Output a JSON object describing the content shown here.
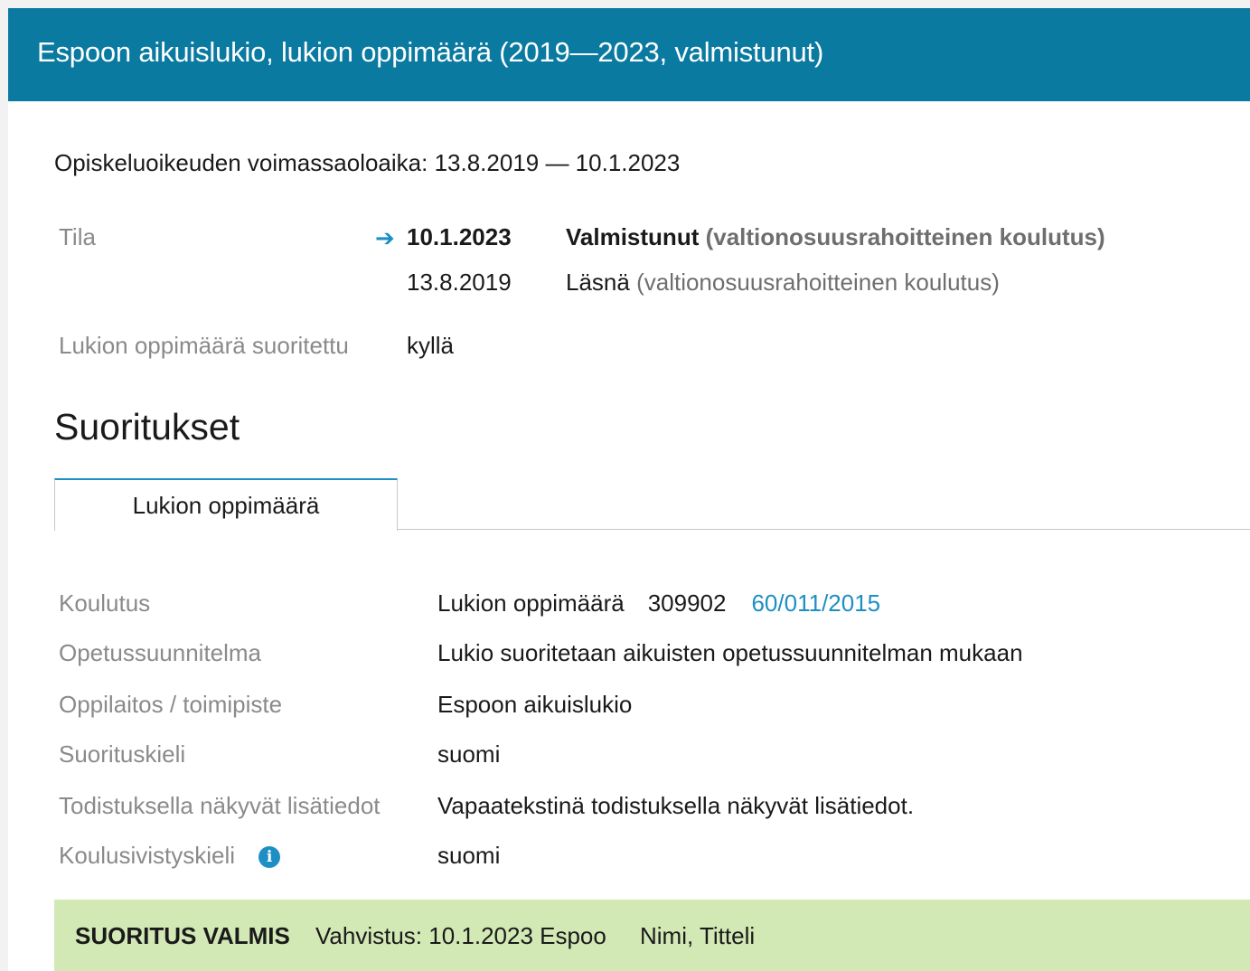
{
  "header": {
    "title": "Espoon aikuislukio, lukion oppimäärä (2019—2023, valmistunut)"
  },
  "validity": "Opiskeluoikeuden voimassaoloaika: 13.8.2019 — 10.1.2023",
  "tila": {
    "label": "Tila",
    "entries": [
      {
        "date": "10.1.2023",
        "state": "Valmistunut",
        "funding": "(valtionosuusrahoitteinen koulutus)",
        "current": true
      },
      {
        "date": "13.8.2019",
        "state": "Läsnä",
        "funding": "(valtionosuusrahoitteinen koulutus)",
        "current": false
      }
    ]
  },
  "completed": {
    "label": "Lukion oppimäärä suoritettu",
    "value": "kyllä"
  },
  "section_title": "Suoritukset",
  "tabs": [
    {
      "label": "Lukion oppimäärä",
      "active": true
    }
  ],
  "details": {
    "koulutus": {
      "label": "Koulutus",
      "name": "Lukion oppimäärä",
      "code": "309902",
      "link": "60/011/2015"
    },
    "opetussuunnitelma": {
      "label": "Opetussuunnitelma",
      "value": "Lukio suoritetaan aikuisten opetussuunnitelman mukaan"
    },
    "oppilaitos": {
      "label": "Oppilaitos / toimipiste",
      "value": "Espoon aikuislukio"
    },
    "suorituskieli": {
      "label": "Suorituskieli",
      "value": "suomi"
    },
    "lisatiedot": {
      "label": "Todistuksella näkyvät lisätiedot",
      "value": "Vapaatekstinä todistuksella näkyvät lisätiedot."
    },
    "koulusivistyskieli": {
      "label": "Koulusivistyskieli",
      "value": "suomi",
      "icon": "info-icon",
      "icon_glyph": "i"
    }
  },
  "status": {
    "label": "SUORITUS VALMIS",
    "confirmation": "Vahvistus: 10.1.2023 Espoo",
    "signer": "Nimi, Titteli"
  },
  "colors": {
    "header_bg": "#0a7aa0",
    "accent": "#1d8fc4",
    "status_bg": "#d2e8b5"
  }
}
